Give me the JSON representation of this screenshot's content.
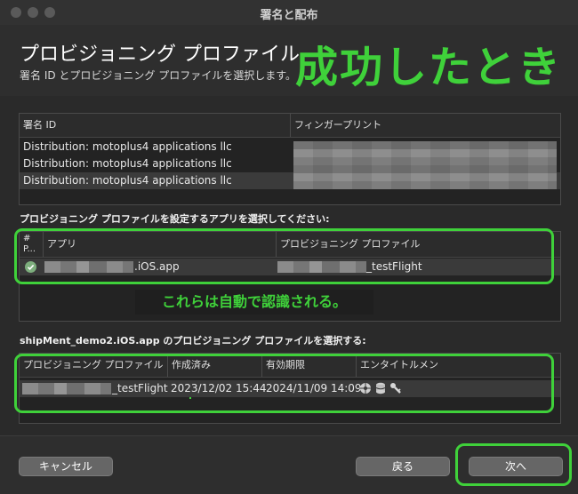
{
  "window": {
    "title": "署名と配布"
  },
  "header": {
    "title": "プロビジョニング プロファイル",
    "subtitle": "署名 ID とプロビジョニング プロファイルを選択します。",
    "annotation": "成功したとき"
  },
  "signing": {
    "columns": [
      "署名 ID",
      "フィンガープリント"
    ],
    "rows": [
      {
        "id": "Distribution: motoplus4 applications llc"
      },
      {
        "id": "Distribution: motoplus4 applications llc"
      },
      {
        "id": "Distribution: motoplus4 applications llc"
      }
    ]
  },
  "apps": {
    "label": "プロビジョニング プロファイルを設定するアプリを選択してください:",
    "columns": {
      "marker": "#\nP...",
      "app": "アプリ",
      "profile": "プロビジョニング プロファイル"
    },
    "row": {
      "app": ".iOS.app",
      "profile": "_testFlight"
    },
    "annotation": "これらは自動で認識される。"
  },
  "profiles": {
    "label": "shipMent_demo2.iOS.app のプロビジョニング プロファイルを選択する:",
    "columns": {
      "name": "プロビジョニング プロファイル",
      "created": "作成済み",
      "expires": "有効期限",
      "entitlements": "エンタイトルメント"
    },
    "row": {
      "name": "_testFlight",
      "created": "2023/12/02 15:44",
      "expires": "2024/11/09 14:09"
    }
  },
  "footer": {
    "cancel": "キャンセル",
    "back": "戻る",
    "next": "次へ"
  },
  "colors": {
    "highlight": "#3fd13a"
  },
  "icons": [
    "check-circle-icon",
    "gear-icon",
    "database-icon",
    "key-icon"
  ]
}
